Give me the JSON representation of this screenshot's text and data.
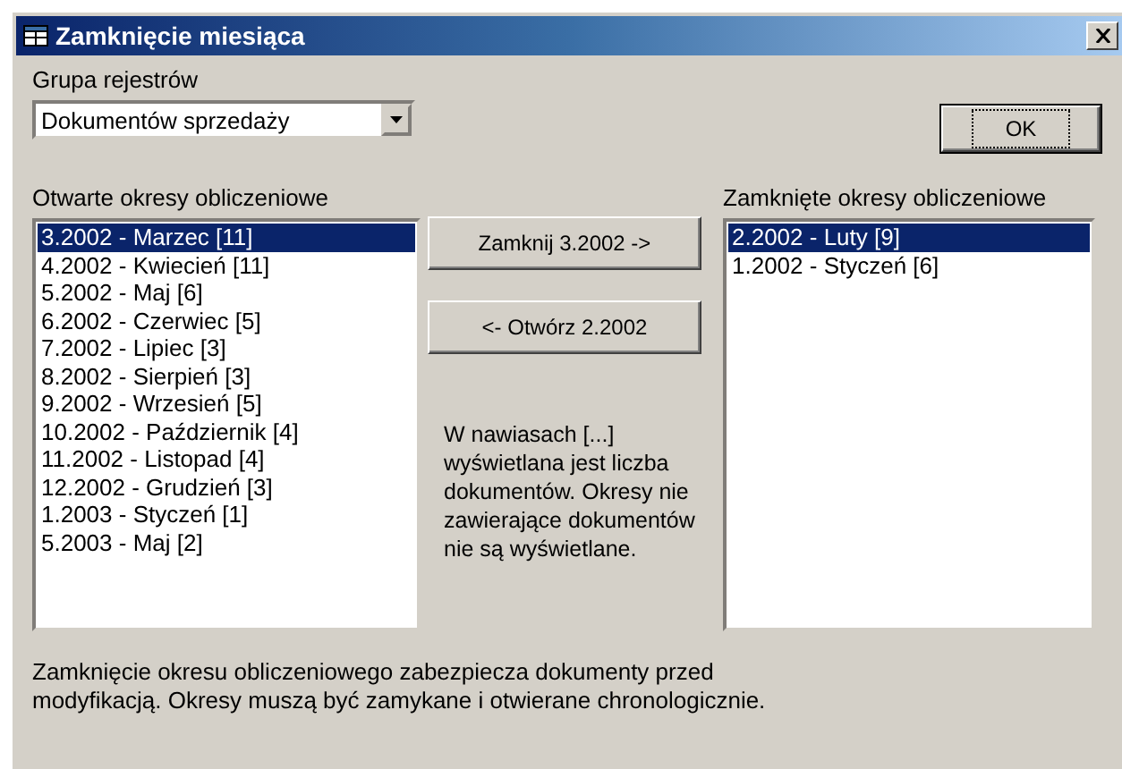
{
  "window": {
    "title": "Zamknięcie miesiąca"
  },
  "group": {
    "label": "Grupa rejestrów",
    "value": "Dokumentów sprzedaży"
  },
  "ok_button": "OK",
  "open_periods": {
    "label": "Otwarte okresy obliczeniowe",
    "items": [
      {
        "text": "3.2002 - Marzec [11]",
        "selected": true
      },
      {
        "text": "4.2002 - Kwiecień [11]",
        "selected": false
      },
      {
        "text": "5.2002 - Maj [6]",
        "selected": false
      },
      {
        "text": "6.2002 - Czerwiec [5]",
        "selected": false
      },
      {
        "text": "7.2002 - Lipiec [3]",
        "selected": false
      },
      {
        "text": "8.2002 - Sierpień [3]",
        "selected": false
      },
      {
        "text": "9.2002 - Wrzesień [5]",
        "selected": false
      },
      {
        "text": "10.2002 - Październik [4]",
        "selected": false
      },
      {
        "text": "11.2002 - Listopad [4]",
        "selected": false
      },
      {
        "text": "12.2002 - Grudzień [3]",
        "selected": false
      },
      {
        "text": "1.2003 - Styczeń [1]",
        "selected": false
      },
      {
        "text": "5.2003 - Maj [2]",
        "selected": false
      }
    ]
  },
  "actions": [
    "Zamknij 3.2002 ->",
    "<- Otwórz 2.2002"
  ],
  "hint": "W nawiasach [...] wyświetlana jest liczba dokumentów. Okresy nie zawierające dokumentów nie są wyświetlane.",
  "closed_periods": {
    "label": "Zamknięte okresy obliczeniowe",
    "items": [
      {
        "text": "2.2002 - Luty [9]",
        "selected": true
      },
      {
        "text": "1.2002 - Styczeń [6]",
        "selected": false
      }
    ]
  },
  "footer": "Zamknięcie okresu obliczeniowego zabezpiecza dokumenty przed modyfikacją. Okresy muszą być zamykane i otwierane chronologicznie."
}
